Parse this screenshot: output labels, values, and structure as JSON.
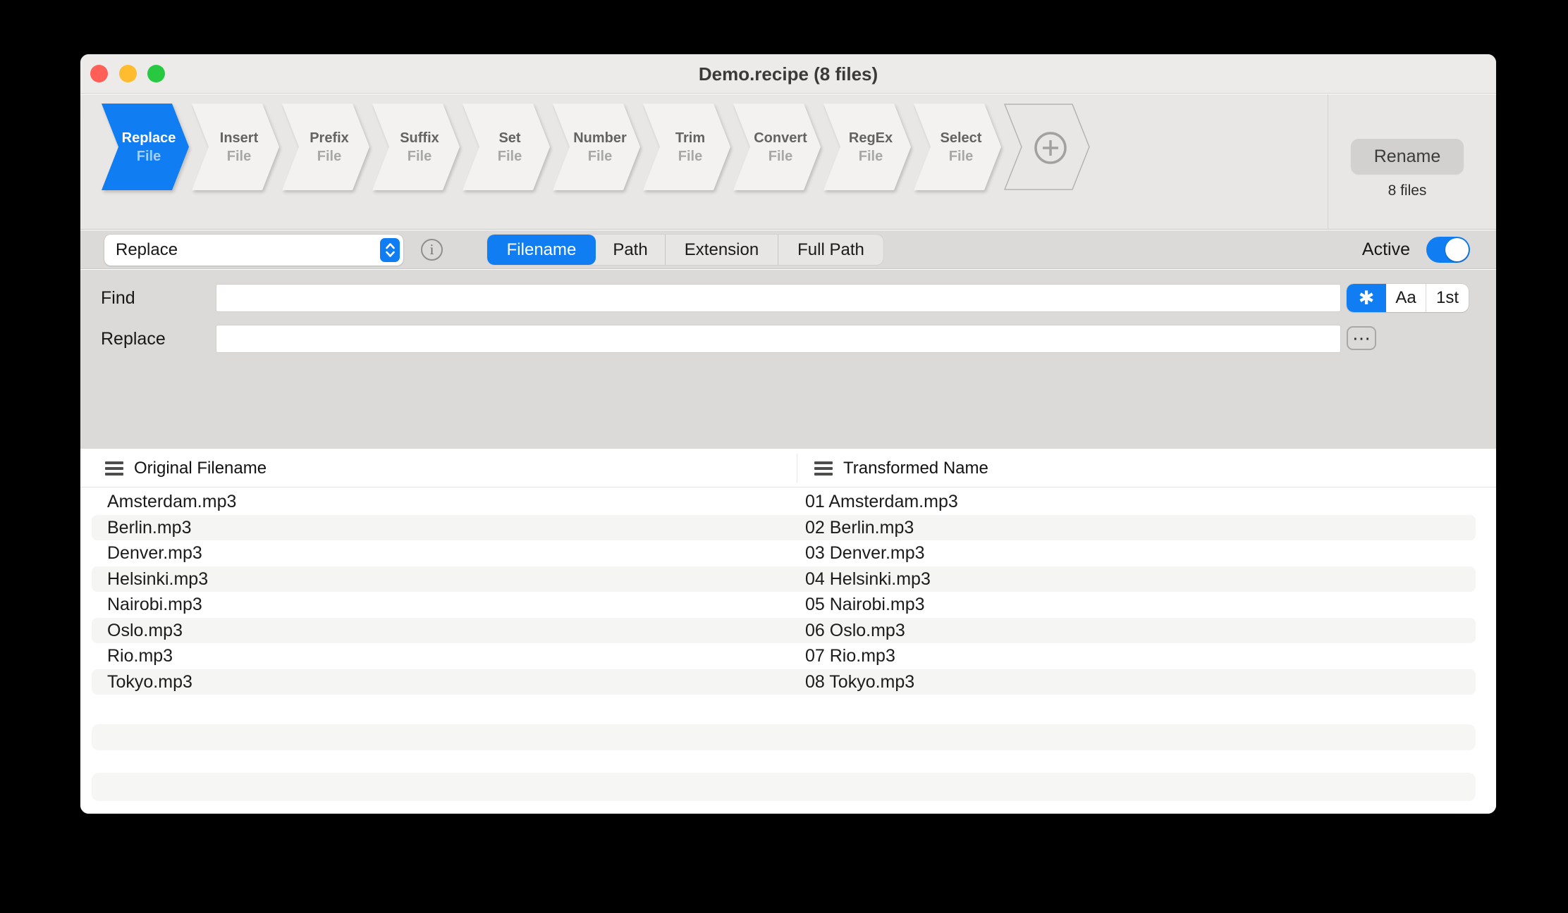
{
  "window": {
    "title": "Demo.recipe (8 files)"
  },
  "steps": [
    {
      "line1": "Replace",
      "line2": "File"
    },
    {
      "line1": "Insert",
      "line2": "File"
    },
    {
      "line1": "Prefix",
      "line2": "File"
    },
    {
      "line1": "Suffix",
      "line2": "File"
    },
    {
      "line1": "Set",
      "line2": "File"
    },
    {
      "line1": "Number",
      "line2": "File"
    },
    {
      "line1": "Trim",
      "line2": "File"
    },
    {
      "line1": "Convert",
      "line2": "File"
    },
    {
      "line1": "RegEx",
      "line2": "File"
    },
    {
      "line1": "Select",
      "line2": "File"
    }
  ],
  "active_step_index": 0,
  "rename": {
    "button_label": "Rename",
    "files_count": "8 files"
  },
  "options": {
    "action_select": {
      "value": "Replace"
    },
    "scope_segments": [
      "Filename",
      "Path",
      "Extension",
      "Full Path"
    ],
    "scope_selected": "Filename",
    "active_label": "Active",
    "active_on": true
  },
  "find_replace": {
    "find_label": "Find",
    "find_value": "",
    "replace_label": "Replace",
    "replace_value": "",
    "match_segments": [
      "✱",
      "Aa",
      "1st"
    ],
    "match_selected": "✱",
    "more_button": "⋯"
  },
  "colors": {
    "accent": "#107ef2",
    "traffic_red": "#ff5f57",
    "traffic_yellow": "#febc2e",
    "traffic_green": "#28c840"
  },
  "table": {
    "columns": [
      "Original Filename",
      "Transformed Name"
    ],
    "rows": [
      [
        "Amsterdam.mp3",
        "01 Amsterdam.mp3"
      ],
      [
        "Berlin.mp3",
        "02 Berlin.mp3"
      ],
      [
        "Denver.mp3",
        "03 Denver.mp3"
      ],
      [
        "Helsinki.mp3",
        "04 Helsinki.mp3"
      ],
      [
        "Nairobi.mp3",
        "05 Nairobi.mp3"
      ],
      [
        "Oslo.mp3",
        "06 Oslo.mp3"
      ],
      [
        "Rio.mp3",
        "07 Rio.mp3"
      ],
      [
        "Tokyo.mp3",
        "08 Tokyo.mp3"
      ]
    ]
  }
}
